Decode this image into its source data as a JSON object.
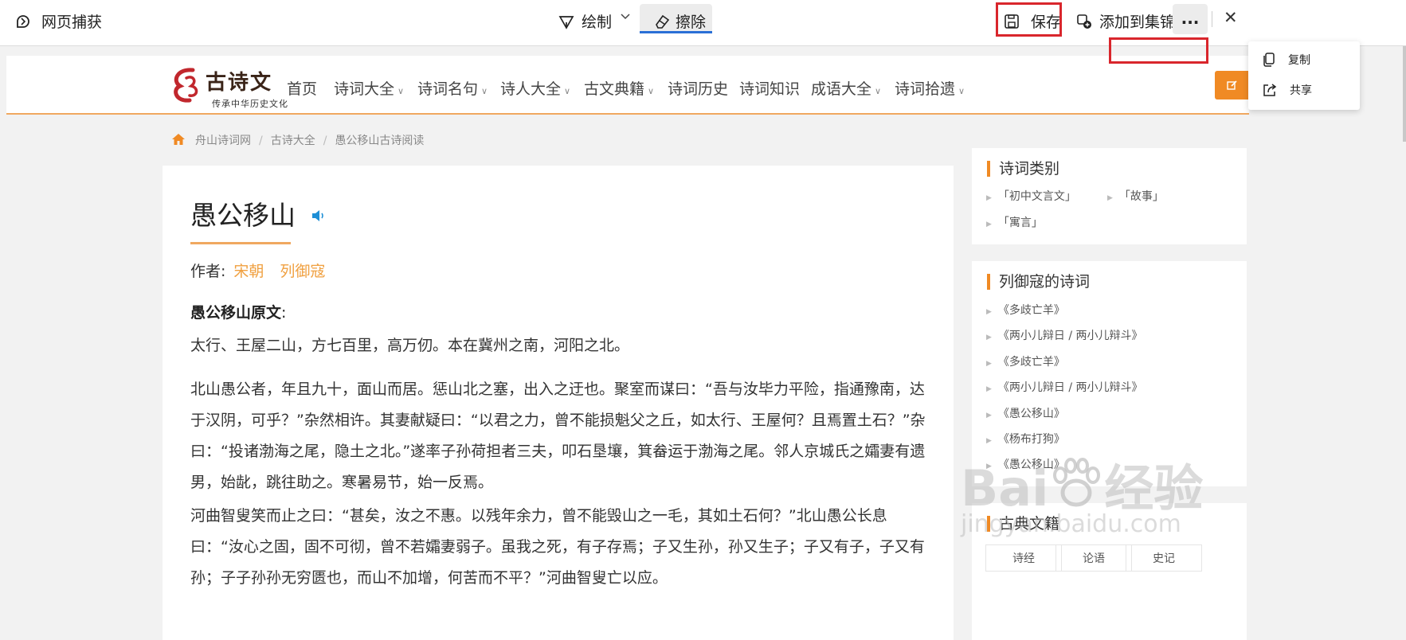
{
  "capture_toolbar": {
    "title": "网页捕获",
    "draw_label": "绘制",
    "erase_label": "擦除",
    "save_label": "保存",
    "add_collection_label": "添加到集锦",
    "more_label": "...",
    "close_label": "✕"
  },
  "more_menu": {
    "items": [
      {
        "label": "复制",
        "icon": "copy-icon"
      },
      {
        "label": "共享",
        "icon": "share-icon"
      }
    ]
  },
  "site": {
    "logo_title": "古诗文",
    "logo_subtitle": "传承中华历史文化",
    "nav": [
      {
        "label": "首页",
        "dropdown": false
      },
      {
        "label": "诗词大全",
        "dropdown": true
      },
      {
        "label": "诗词名句",
        "dropdown": true
      },
      {
        "label": "诗人大全",
        "dropdown": true
      },
      {
        "label": "古文典籍",
        "dropdown": true
      },
      {
        "label": "诗词历史",
        "dropdown": false
      },
      {
        "label": "诗词知识",
        "dropdown": false
      },
      {
        "label": "成语大全",
        "dropdown": true
      },
      {
        "label": "诗词拾遗",
        "dropdown": true
      }
    ],
    "accent": "#f08a24"
  },
  "breadcrumb": [
    "舟山诗词网",
    "古诗大全",
    "愚公移山古诗阅读"
  ],
  "article": {
    "title": "愚公移山",
    "author_label": "作者:",
    "dynasty": "宋朝",
    "author": "列御寇",
    "section_title": "愚公移山原文",
    "section_colon": ":",
    "paragraphs": [
      "太行、王屋二山，方七百里，高万仞。本在冀州之南，河阳之北。",
      "北山愚公者，年且九十，面山而居。惩山北之塞，出入之迂也。聚室而谋曰：“吾与汝毕力平险，指通豫南，达于汉阴，可乎？”杂然相许。其妻献疑曰：“以君之力，曾不能损魁父之丘，如太行、王屋何？且焉置土石？”杂曰：“投诸渤海之尾，隐土之北。”遂率子孙荷担者三夫，叩石垦壤，箕畚运于渤海之尾。邻人京城氏之孀妻有遗男，始龀，跳往助之。寒暑易节，始一反焉。",
      "河曲智叟笑而止之曰：“甚矣，汝之不惠。以残年余力，曾不能毁山之一毛，其如土石何？”北山愚公长息曰：“汝心之固，固不可彻，曾不若孀妻弱子。虽我之死，有子存焉；子又生孙，孙又生子；子又有子，子又有孙；子子孙孙无穷匮也，而山不加增，何苦而不平？”河曲智叟亡以应。"
    ]
  },
  "sidebar": {
    "categories": {
      "title": "诗词类别",
      "items": [
        "「初中文言文」",
        "「故事」",
        "「寓言」"
      ]
    },
    "poems": {
      "title": "列御寇的诗词",
      "items": [
        "《多歧亡羊》",
        "《两小儿辩日 / 两小儿辩斗》",
        "《多歧亡羊》",
        "《两小儿辩日 / 两小儿辩斗》",
        "《愚公移山》",
        "《杨布打狗》",
        "《愚公移山》"
      ]
    },
    "books": {
      "title": "古典文籍",
      "items": [
        "诗经",
        "论语",
        "史记"
      ]
    }
  },
  "watermark": {
    "brand": "Bai",
    "brand_tail": "经验",
    "url": "jingyan.baidu.com"
  }
}
